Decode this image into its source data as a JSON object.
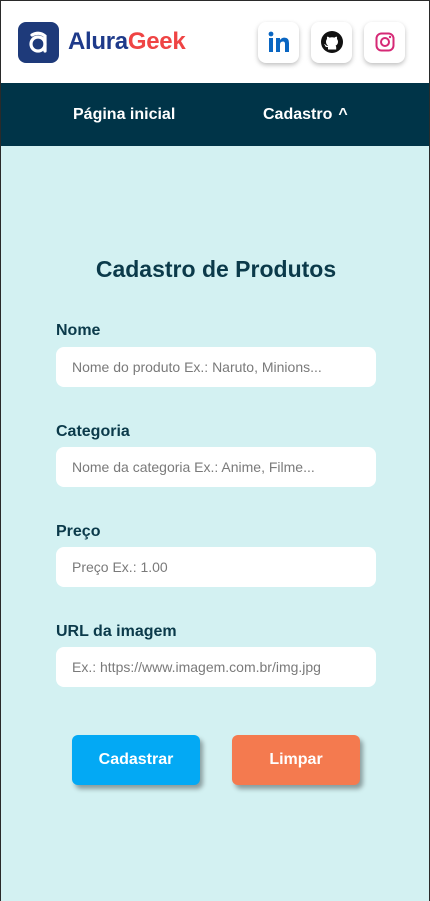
{
  "header": {
    "brand_part1": "Alura",
    "brand_part2": "Geek",
    "social_icons": [
      "linkedin-icon",
      "github-icon",
      "instagram-icon"
    ]
  },
  "nav": {
    "home_label": "Página inicial",
    "cadastro_label": "Cadastro",
    "cadastro_chevron": "^"
  },
  "form": {
    "title": "Cadastro de Produtos",
    "nome_label": "Nome",
    "nome_placeholder": "Nome do produto Ex.: Naruto, Minions...",
    "categoria_label": "Categoria",
    "categoria_placeholder": "Nome da categoria Ex.: Anime, Filme...",
    "preco_label": "Preço",
    "preco_placeholder": "Preço Ex.: 1.00",
    "url_label": "URL da imagem",
    "url_placeholder": "Ex.: https://www.imagem.com.br/img.jpg",
    "submit_label": "Cadastrar",
    "clear_label": "Limpar"
  },
  "colors": {
    "background": "#d3f1f2",
    "navbar": "#003448",
    "brand_blue": "#1e3a8a",
    "brand_red": "#ef4444",
    "submit_button": "#03a9f4",
    "clear_button": "#f47a4f"
  }
}
